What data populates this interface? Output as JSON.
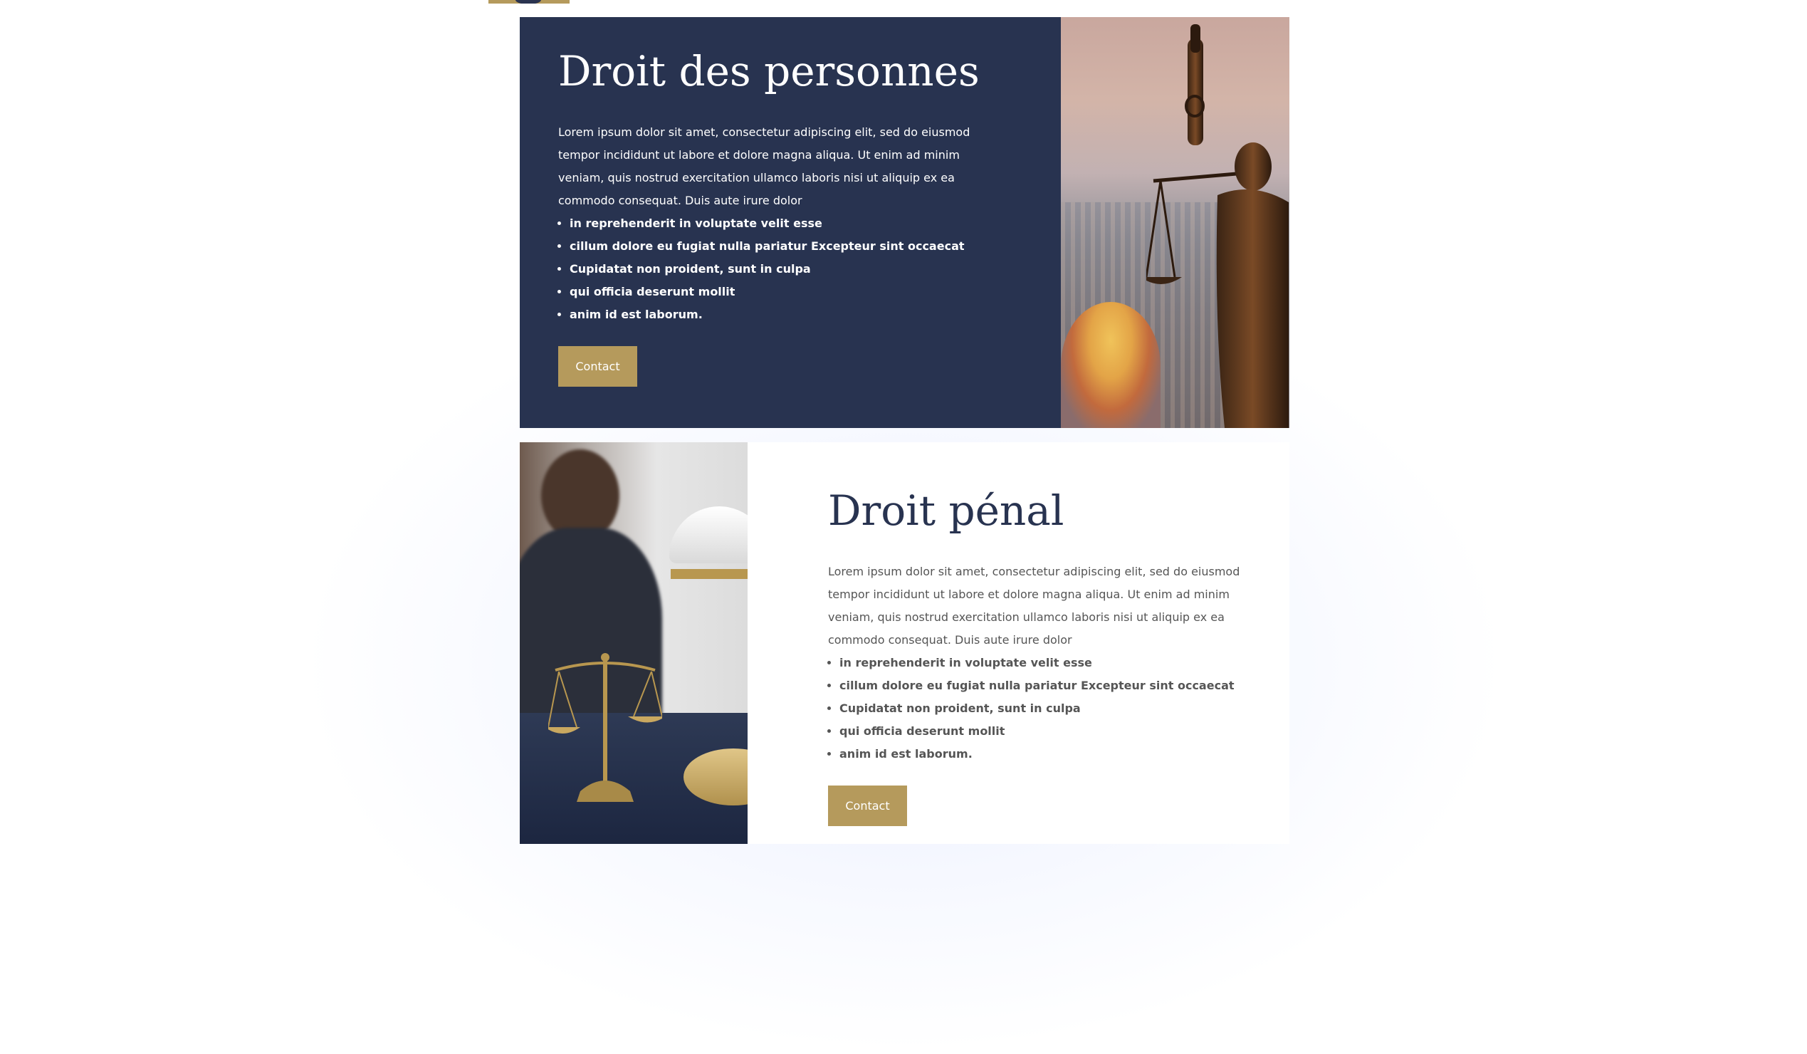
{
  "sections": [
    {
      "title": "Droit des personnes",
      "paragraph": "Lorem ipsum dolor sit amet, consectetur adipiscing elit, sed do eiusmod tempor incididunt ut labore et dolore magna aliqua. Ut enim ad minim veniam, quis nostrud exercitation ullamco laboris nisi ut aliquip ex ea commodo consequat. Duis aute irure dolor",
      "bullets": [
        "in reprehenderit in voluptate velit esse",
        "cillum dolore eu fugiat nulla pariatur Excepteur sint occaecat",
        "Cupidatat non proident, sunt in culpa",
        "qui officia deserunt mollit",
        "anim id est laborum."
      ],
      "button_label": "Contact"
    },
    {
      "title": "Droit pénal",
      "paragraph": "Lorem ipsum dolor sit amet, consectetur adipiscing elit, sed do eiusmod tempor incididunt ut labore et dolore magna aliqua. Ut enim ad minim veniam, quis nostrud exercitation ullamco laboris nisi ut aliquip ex ea commodo consequat. Duis aute irure dolor",
      "bullets": [
        "in reprehenderit in voluptate velit esse",
        "cillum dolore eu fugiat nulla pariatur Excepteur sint occaecat",
        "Cupidatat non proident, sunt in culpa",
        "qui officia deserunt mollit",
        "anim id est laborum."
      ],
      "button_label": "Contact"
    }
  ],
  "colors": {
    "navy": "#283350",
    "gold": "#b59a5c",
    "white": "#ffffff",
    "body_text_light": "#555555"
  },
  "images": {
    "section1": "justice-statue-photo",
    "section2": "lawyer-with-scales-photo"
  }
}
